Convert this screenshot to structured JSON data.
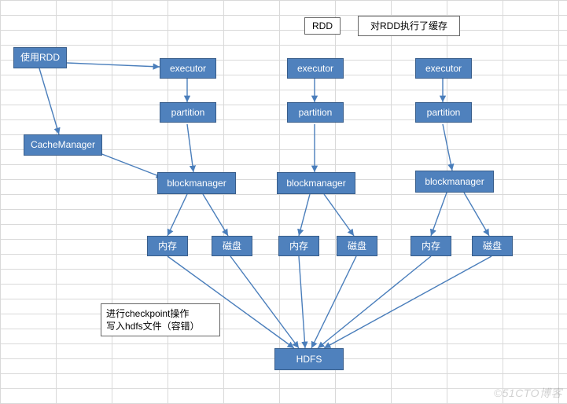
{
  "colors": {
    "node_fill": "#4F81BD",
    "node_border": "#385D8A",
    "arrow": "#4A7EBB",
    "grid": "#d9d9d9"
  },
  "header": {
    "rdd_label": "RDD",
    "cache_label": "对RDD执行了缓存"
  },
  "nodes": {
    "use_rdd": "使用RDD",
    "cache_manager": "CacheManager",
    "executor": "executor",
    "partition": "partition",
    "blockmanager": "blockmanager",
    "memory": "内存",
    "disk": "磁盘",
    "hdfs": "HDFS"
  },
  "note": {
    "checkpoint_line1": "进行checkpoint操作",
    "checkpoint_line2": "写入hdfs文件（容错）"
  },
  "watermark": "©51CTO博客"
}
